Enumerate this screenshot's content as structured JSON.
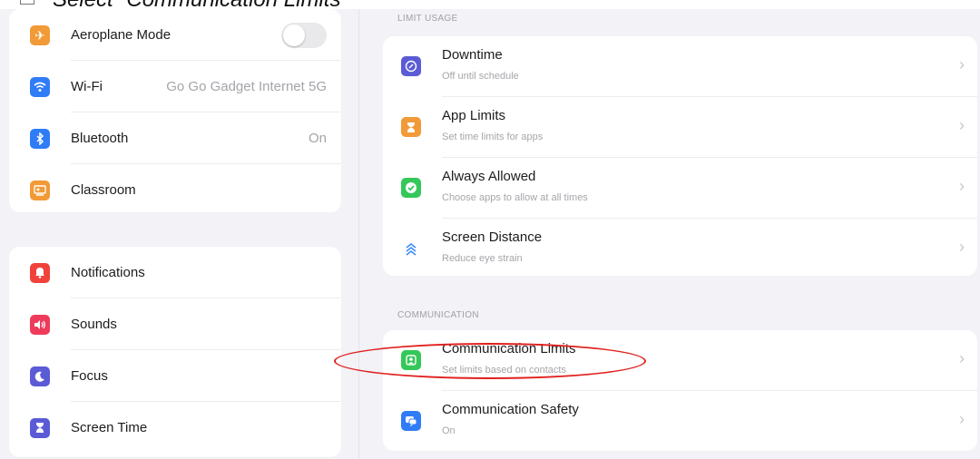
{
  "caption": "Select “Communication Limits”",
  "sidebar": {
    "group1": [
      {
        "label": "Aeroplane Mode",
        "value": "",
        "icon": "airplane-icon",
        "color": "#f19a37",
        "toggle": false
      },
      {
        "label": "Wi-Fi",
        "value": "Go Go Gadget Internet 5G",
        "icon": "wifi-icon",
        "color": "#2f7cf6"
      },
      {
        "label": "Bluetooth",
        "value": "On",
        "icon": "bluetooth-icon",
        "color": "#2f7cf6"
      },
      {
        "label": "Classroom",
        "value": "",
        "icon": "classroom-icon",
        "color": "#f19a37"
      }
    ],
    "group2": [
      {
        "label": "Notifications",
        "icon": "bell-icon",
        "color": "#f0423b"
      },
      {
        "label": "Sounds",
        "icon": "speaker-icon",
        "color": "#ee3b5b"
      },
      {
        "label": "Focus",
        "icon": "moon-icon",
        "color": "#5b5bd6"
      },
      {
        "label": "Screen Time",
        "icon": "hourglass-icon",
        "color": "#5b5bd6"
      }
    ]
  },
  "main": {
    "limit_usage": {
      "header": "LIMIT USAGE",
      "rows": [
        {
          "title": "Downtime",
          "subtitle": "Off until schedule",
          "icon": "downtime-icon",
          "color": "#5b5bd6"
        },
        {
          "title": "App Limits",
          "subtitle": "Set time limits for apps",
          "icon": "hourglass-icon",
          "color": "#f19a37"
        },
        {
          "title": "Always Allowed",
          "subtitle": "Choose apps to allow at all times",
          "icon": "checkmark-icon",
          "color": "#34c759"
        },
        {
          "title": "Screen Distance",
          "subtitle": "Reduce eye strain",
          "icon": "screen-distance-icon",
          "color": "#ffffff"
        }
      ]
    },
    "communication": {
      "header": "COMMUNICATION",
      "rows": [
        {
          "title": "Communication Limits",
          "subtitle": "Set limits based on contacts",
          "icon": "contacts-icon",
          "color": "#34c759"
        },
        {
          "title": "Communication Safety",
          "subtitle": "On",
          "icon": "chat-bubbles-icon",
          "color": "#2f7cf6"
        }
      ]
    }
  },
  "colors": {
    "highlight": "#e0201e",
    "background": "#f2f2f7"
  }
}
